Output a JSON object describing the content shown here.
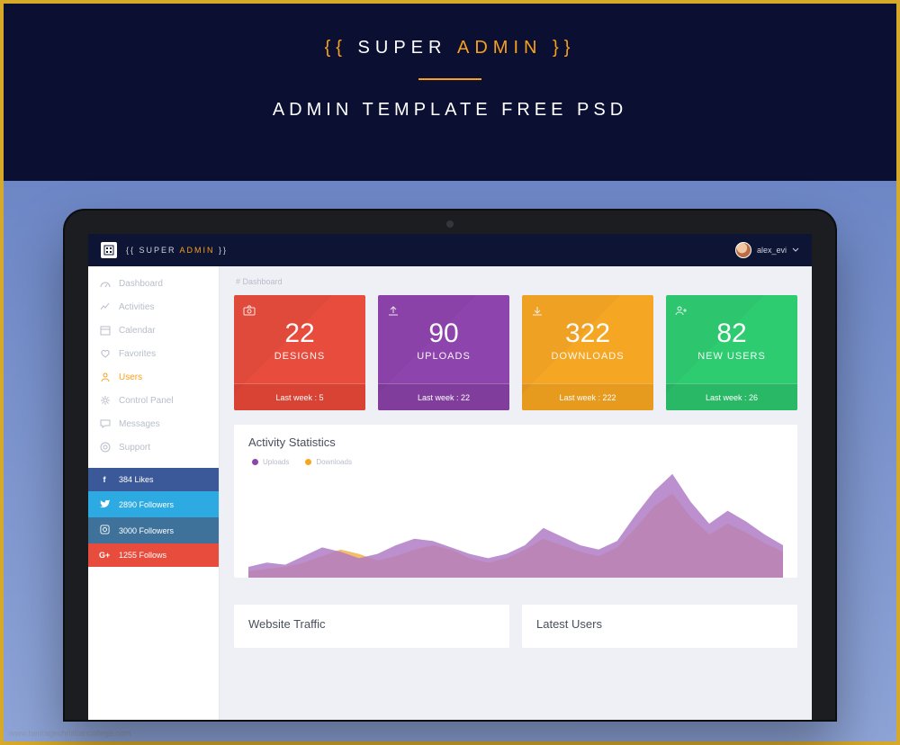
{
  "banner": {
    "brace_open": "{{",
    "brace_close": "}}",
    "word1": "SUPER",
    "word2": "ADMIN",
    "subtitle": "ADMIN TEMPLATE FREE PSD"
  },
  "watermark": "www.heritagechristiancollege.com",
  "topbar": {
    "brand_a": "{{ SUPER ",
    "brand_b": "ADMIN",
    "brand_c": " }}",
    "username": "alex_evi"
  },
  "sidebar": {
    "items": [
      {
        "label": "Dashboard"
      },
      {
        "label": "Activities"
      },
      {
        "label": "Calendar"
      },
      {
        "label": "Favorites"
      },
      {
        "label": "Users",
        "active": true
      },
      {
        "label": "Control Panel"
      },
      {
        "label": "Messages"
      },
      {
        "label": "Support"
      }
    ],
    "social": {
      "facebook": "384 Likes",
      "twitter": "2890 Followers",
      "instagram": "3000 Followers",
      "google": "1255 Follows"
    }
  },
  "main": {
    "breadcrumb": "# Dashboard",
    "cards": [
      {
        "value": "22",
        "label": "DESIGNS",
        "footer": "Last week : 5"
      },
      {
        "value": "90",
        "label": "UPLOADS",
        "footer": "Last week : 22"
      },
      {
        "value": "322",
        "label": "DOWNLOADS",
        "footer": "Last week : 222"
      },
      {
        "value": "82",
        "label": "NEW USERS",
        "footer": "Last week : 26"
      }
    ],
    "activity_title": "Activity Statistics",
    "legend": {
      "a": "Uploads",
      "b": "Downloads"
    },
    "panels": {
      "traffic": "Website Traffic",
      "users": "Latest Users"
    }
  },
  "chart_data": {
    "type": "area",
    "x": [
      0,
      1,
      2,
      3,
      4,
      5,
      6,
      7,
      8,
      9,
      10,
      11,
      12,
      13,
      14,
      15,
      16,
      17,
      18,
      19,
      20,
      21,
      22,
      23,
      24,
      25,
      26,
      27,
      28,
      29
    ],
    "series": [
      {
        "name": "Uploads",
        "color": "#8e44ad",
        "values": [
          10,
          14,
          12,
          20,
          28,
          24,
          18,
          22,
          30,
          36,
          34,
          28,
          22,
          18,
          22,
          30,
          46,
          38,
          30,
          26,
          34,
          58,
          80,
          96,
          70,
          50,
          62,
          52,
          40,
          30
        ]
      },
      {
        "name": "Downloads",
        "color": "#f5a623",
        "values": [
          6,
          8,
          10,
          14,
          20,
          26,
          22,
          16,
          20,
          26,
          30,
          26,
          18,
          14,
          18,
          26,
          36,
          30,
          24,
          20,
          28,
          46,
          66,
          78,
          56,
          40,
          50,
          42,
          32,
          24
        ]
      }
    ],
    "ylim": [
      0,
      100
    ]
  }
}
